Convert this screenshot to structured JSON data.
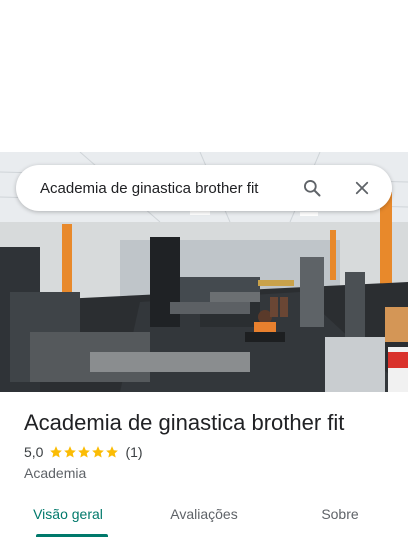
{
  "search": {
    "query": "Academia de ginastica brother fit",
    "search_icon": "search-icon",
    "close_icon": "close-icon"
  },
  "place": {
    "name": "Academia de ginastica brother fit",
    "rating": "5,0",
    "rating_value": 5.0,
    "rating_max": 5,
    "review_count": "(1)",
    "category": "Academia"
  },
  "tabs": [
    {
      "label": "Visão geral",
      "active": true
    },
    {
      "label": "Avaliações",
      "active": false
    },
    {
      "label": "Sobre",
      "active": false
    }
  ],
  "colors": {
    "accent": "#00796b",
    "star": "#fbbc04",
    "title_text": "#202124",
    "secondary_text": "#5f6368"
  }
}
